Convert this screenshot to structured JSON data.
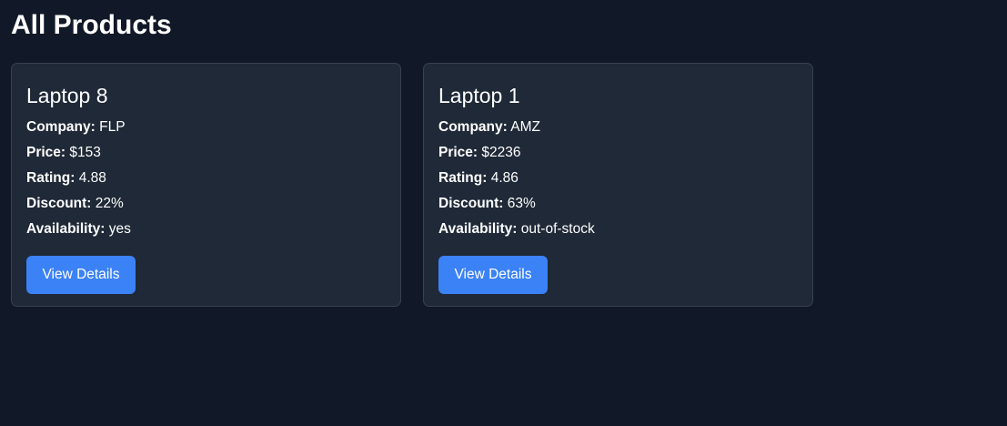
{
  "page": {
    "title": "All Products"
  },
  "labels": {
    "company": "Company:",
    "price": "Price:",
    "rating": "Rating:",
    "discount": "Discount:",
    "availability": "Availability:"
  },
  "products": [
    {
      "name": "Laptop 8",
      "company": "FLP",
      "price": "$153",
      "rating": "4.88",
      "discount": "22%",
      "availability": "yes",
      "button_label": "View Details"
    },
    {
      "name": "Laptop 1",
      "company": "AMZ",
      "price": "$2236",
      "rating": "4.86",
      "discount": "63%",
      "availability": "out-of-stock",
      "button_label": "View Details"
    }
  ],
  "colors": {
    "background": "#111827",
    "card": "#1f2937",
    "card_border": "#374151",
    "button": "#3b82f6"
  }
}
